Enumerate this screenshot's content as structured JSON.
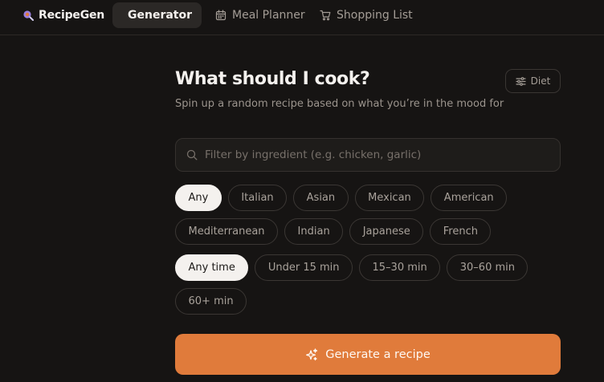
{
  "nav": {
    "brand": "RecipeGen",
    "brand_icon": "magnifier-logo-icon",
    "tabs": [
      {
        "label": "Generator",
        "icon": "shuffle-icon",
        "active": true
      },
      {
        "label": "Meal Planner",
        "icon": "calendar-icon",
        "active": false
      },
      {
        "label": "Shopping List",
        "icon": "cart-icon",
        "active": false
      }
    ]
  },
  "main": {
    "title": "What should I cook?",
    "subtitle": "Spin up a random recipe based on what you’re in the mood for",
    "diet_button": {
      "label": "Diet",
      "icon": "sliders-icon"
    },
    "search": {
      "placeholder": "Filter by ingredient (e.g. chicken, garlic)",
      "value": "",
      "icon": "search-icon"
    },
    "cuisines": [
      "Any",
      "Italian",
      "Asian",
      "Mexican",
      "American",
      "Mediterranean",
      "Indian",
      "Japanese",
      "French"
    ],
    "cuisine_selected": "Any",
    "times": [
      "Any time",
      "Under 15 min",
      "15–30 min",
      "30–60 min",
      "60+ min"
    ],
    "time_selected": "Any time",
    "generate_button": {
      "label": "Generate a recipe",
      "icon": "sparkles-icon"
    }
  },
  "colors": {
    "background": "#161413",
    "accent": "#e07b3b",
    "chip_selected_bg": "#f4f1ee",
    "brand_icon": "#9b7fe0"
  }
}
